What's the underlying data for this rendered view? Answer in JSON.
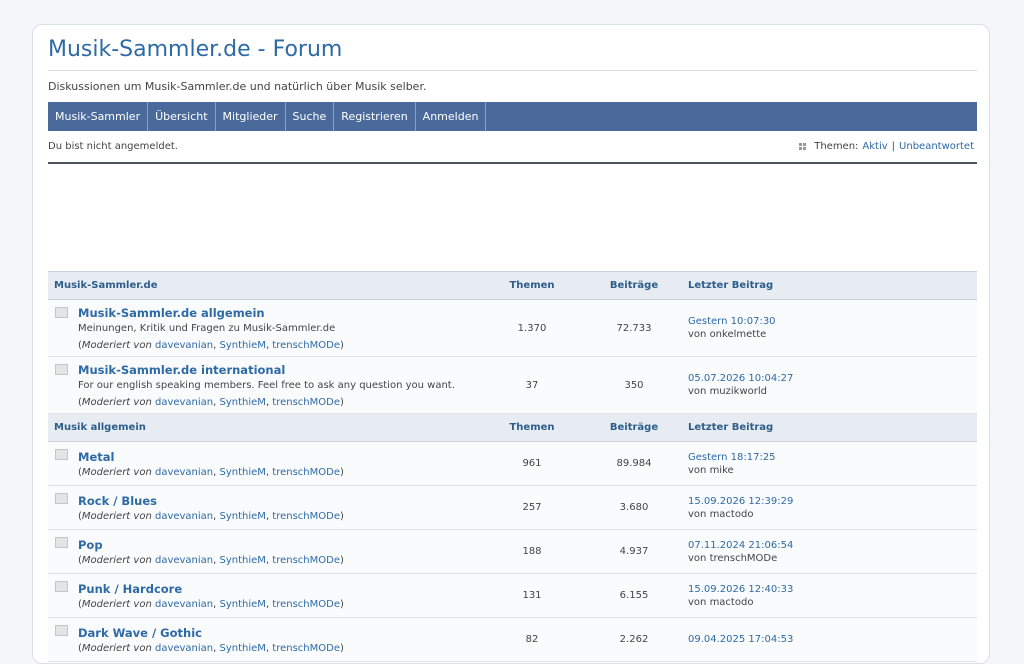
{
  "header": {
    "title": "Musik-Sammler.de - Forum",
    "description": "Diskussionen um Musik-Sammler.de und natürlich über Musik selber."
  },
  "nav": [
    "Musik-Sammler",
    "Übersicht",
    "Mitglieder",
    "Suche",
    "Registrieren",
    "Anmelden"
  ],
  "status": {
    "text": "Du bist nicht angemeldet.",
    "topics_label": "Themen:",
    "active": "Aktiv",
    "separator": "|",
    "unanswered": "Unbeantwortet"
  },
  "moderators_label": "Moderiert von",
  "moderators": [
    "davevanian",
    "SynthieM",
    "trenschMODe"
  ],
  "author_prefix": "von",
  "categories": [
    {
      "name": "Musik-Sammler.de",
      "col_topics": "Themen",
      "col_posts": "Beiträge",
      "col_last": "Letzter Beitrag",
      "forums": [
        {
          "name": "Musik-Sammler.de allgemein",
          "desc": "Meinungen, Kritik und Fragen zu Musik-Sammler.de",
          "topics": "1.370",
          "posts": "72.733",
          "last_date": "Gestern 10:07:30",
          "last_by": "onkelmette"
        },
        {
          "name": "Musik-Sammler.de international",
          "desc": "For our english speaking members. Feel free to ask any question you want.",
          "topics": "37",
          "posts": "350",
          "last_date": "05.07.2026 10:04:27",
          "last_by": "muzikworld"
        }
      ]
    },
    {
      "name": "Musik allgemein",
      "col_topics": "Themen",
      "col_posts": "Beiträge",
      "col_last": "Letzter Beitrag",
      "forums": [
        {
          "name": "Metal",
          "desc": "",
          "topics": "961",
          "posts": "89.984",
          "last_date": "Gestern 18:17:25",
          "last_by": "mike"
        },
        {
          "name": "Rock / Blues",
          "desc": "",
          "topics": "257",
          "posts": "3.680",
          "last_date": "15.09.2026 12:39:29",
          "last_by": "mactodo"
        },
        {
          "name": "Pop",
          "desc": "",
          "topics": "188",
          "posts": "4.937",
          "last_date": "07.11.2024 21:06:54",
          "last_by": "trenschMODe"
        },
        {
          "name": "Punk / Hardcore",
          "desc": "",
          "topics": "131",
          "posts": "6.155",
          "last_date": "15.09.2026 12:40:33",
          "last_by": "mactodo"
        },
        {
          "name": "Dark Wave / Gothic",
          "desc": "",
          "topics": "82",
          "posts": "2.262",
          "last_date": "09.04.2025 17:04:53",
          "last_by": ""
        }
      ]
    }
  ]
}
